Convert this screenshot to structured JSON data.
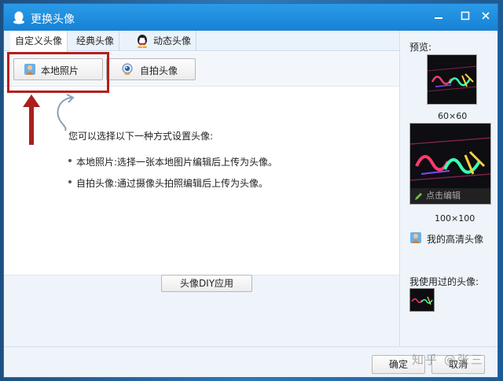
{
  "window": {
    "title": "更换头像",
    "min_icon": "minimize-icon",
    "max_icon": "maximize-icon",
    "close_icon": "close-icon"
  },
  "tabs": [
    {
      "label": "自定义头像"
    },
    {
      "label": "经典头像"
    },
    {
      "label": "动态头像",
      "icon": "penguin-icon"
    }
  ],
  "subtoolbar": {
    "local_photo": "本地照片",
    "selfie": "自拍头像"
  },
  "info": {
    "title": "您可以选择以下一种方式设置头像:",
    "items": [
      "本地照片:选择一张本地图片编辑后上传为头像。",
      "自拍头像:通过摄像头拍照编辑后上传为头像。"
    ]
  },
  "diy_button": "头像DIY应用",
  "sidebar": {
    "preview_label": "预览:",
    "size_60": "60×60",
    "size_100": "100×100",
    "click_edit": "点击编辑",
    "hd_avatar": "我的高清头像",
    "used_label": "我使用过的头像:"
  },
  "footer": {
    "ok": "确定",
    "cancel": "取消"
  },
  "watermark": "知乎 @张三",
  "colors": {
    "titlebar": "#1781d4",
    "highlight": "#b3201c"
  }
}
